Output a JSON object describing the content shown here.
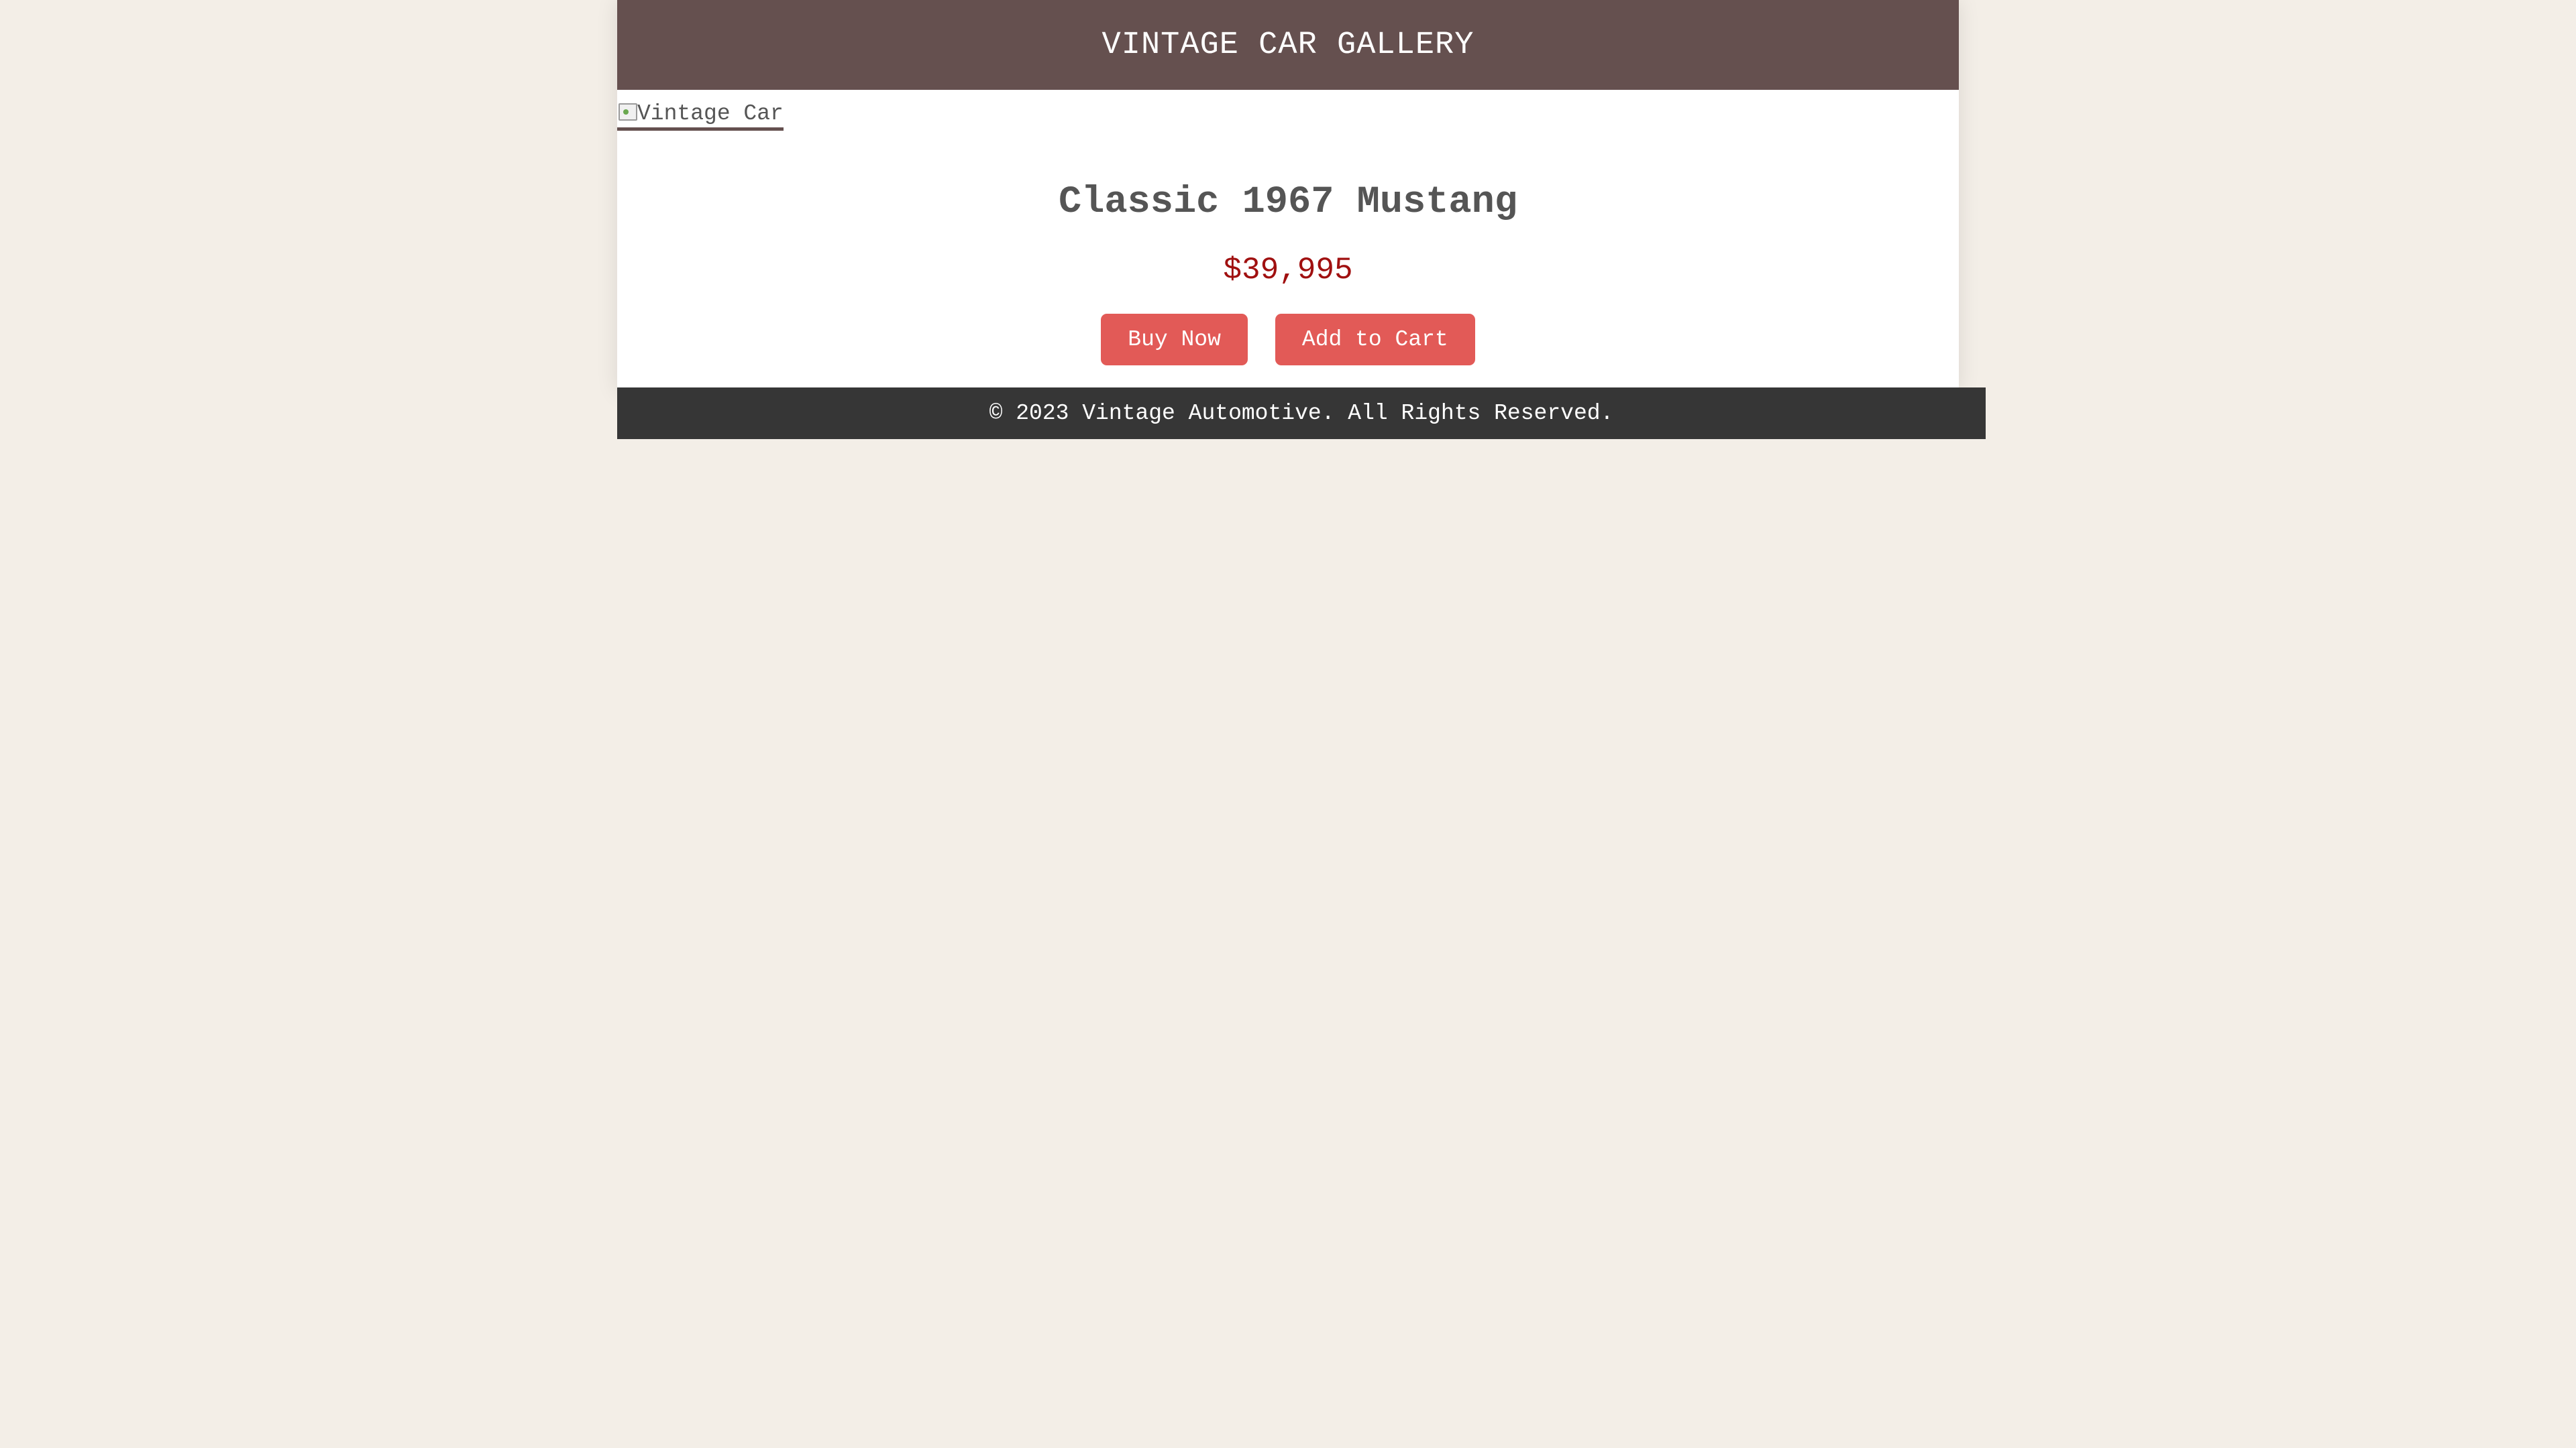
{
  "header": {
    "title": "VINTAGE CAR GALLERY"
  },
  "product": {
    "image_alt": "Vintage Car",
    "title": "Classic 1967 Mustang",
    "price": "$39,995",
    "buttons": {
      "buy_now": "Buy Now",
      "add_to_cart": "Add to Cart"
    }
  },
  "footer": {
    "copyright": "© 2023 Vintage Automotive. All Rights Reserved."
  },
  "colors": {
    "page_background": "#f3eee7",
    "header_background": "#65504f",
    "accent_button": "#e25a57",
    "price_text": "#a01010",
    "footer_background": "#363636"
  }
}
